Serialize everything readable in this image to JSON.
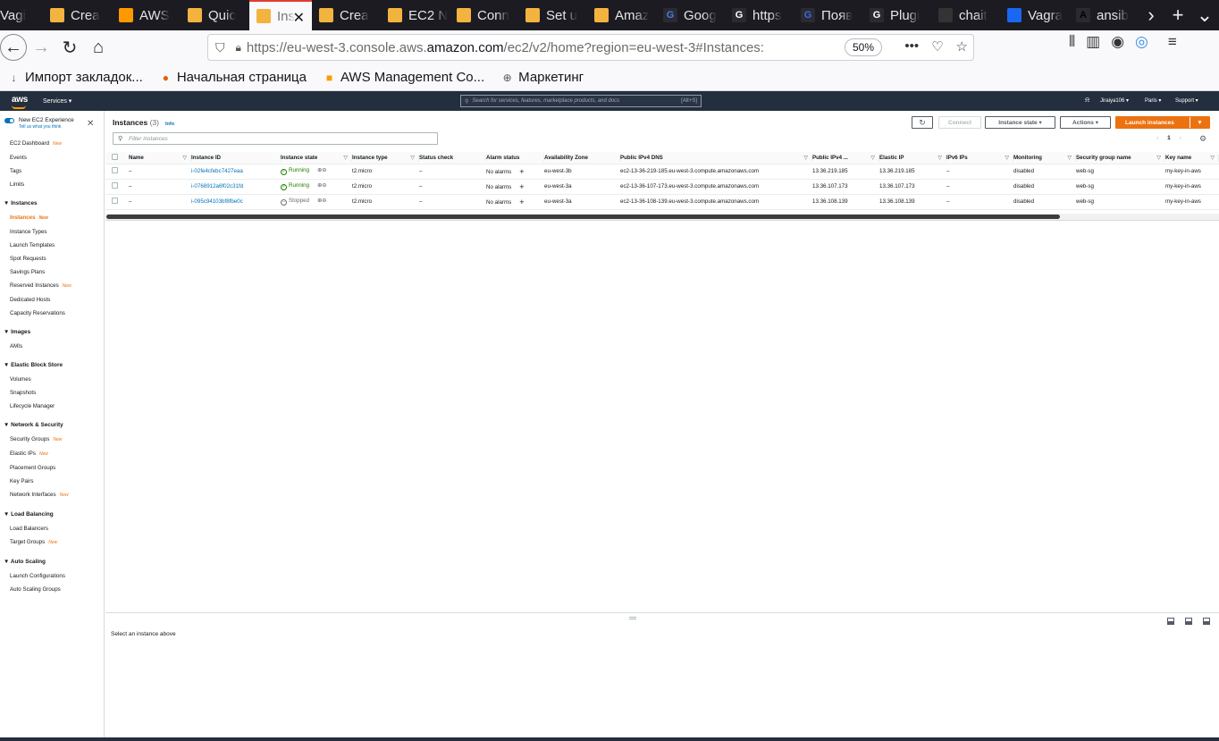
{
  "browser": {
    "tabs": [
      {
        "title": "Vagi",
        "fav": "",
        "fav_color": "#555"
      },
      {
        "title": "Crea",
        "fav": "",
        "fav_color": "#f3b33f"
      },
      {
        "title": "AWS",
        "fav": "",
        "fav_color": "#ff9900"
      },
      {
        "title": "Quic",
        "fav": "",
        "fav_color": "#f3b33f"
      },
      {
        "title": "Ins",
        "fav": "",
        "fav_color": "#f3b33f",
        "active": true
      },
      {
        "title": "Crea",
        "fav": "",
        "fav_color": "#f3b33f"
      },
      {
        "title": "EC2 N",
        "fav": "",
        "fav_color": "#f3b33f"
      },
      {
        "title": "Conn",
        "fav": "",
        "fav_color": "#f3b33f"
      },
      {
        "title": "Set u",
        "fav": "",
        "fav_color": "#f3b33f"
      },
      {
        "title": "Amaz",
        "fav": "",
        "fav_color": "#f3b33f"
      },
      {
        "title": "Goog",
        "fav": "G",
        "fav_color": "#4a7bdc"
      },
      {
        "title": "https",
        "fav": "G",
        "fav_color": "#ffffff"
      },
      {
        "title": "Появ",
        "fav": "G",
        "fav_color": "#3b6de0"
      },
      {
        "title": "Plugi",
        "fav": "G",
        "fav_color": "#ffffff"
      },
      {
        "title": "chait",
        "fav": "",
        "fav_color": "#333"
      },
      {
        "title": "Vagra",
        "fav": "",
        "fav_color": "#1868f2"
      },
      {
        "title": "ansib",
        "fav": "A",
        "fav_color": "#000000"
      }
    ],
    "url_prefix": "https://eu-west-3.console.aws.",
    "url_host": "amazon.com",
    "url_suffix": "/ec2/v2/home?region=eu-west-3#Instances:",
    "zoom": "50%",
    "bookmarks": [
      {
        "label": "Импорт закладок...",
        "icon": "↓",
        "icon_color": "#555"
      },
      {
        "label": "Начальная страница",
        "icon": "●",
        "icon_color": "#e66000"
      },
      {
        "label": "AWS Management Co...",
        "icon": "■",
        "icon_color": "#ff9900"
      },
      {
        "label": "Маркетинг",
        "icon": "⊕",
        "icon_color": "#555"
      }
    ]
  },
  "aws_header": {
    "logo": "aws",
    "services": "Services ▾",
    "search_placeholder": "Search for services, features, marketplace products, and docs",
    "search_hotkey": "[Alt+S]",
    "user": "Jiraiya106 ▾",
    "region": "Paris ▾",
    "support": "Support ▾"
  },
  "sidebar": {
    "new_experience": "New EC2 Experience",
    "tell_us": "Tell us what you think",
    "dashboard": "EC2 Dashboard",
    "events": "Events",
    "tags": "Tags",
    "limits": "Limits",
    "new_tag": "New",
    "sections": {
      "instances": "Instances",
      "images": "Images",
      "ebs": "Elastic Block Store",
      "network": "Network & Security",
      "lb": "Load Balancing",
      "as": "Auto Scaling"
    },
    "items": {
      "instances": "Instances",
      "instance_types": "Instance Types",
      "launch_templates": "Launch Templates",
      "spot_requests": "Spot Requests",
      "savings_plans": "Savings Plans",
      "reserved_instances": "Reserved Instances",
      "dedicated_hosts": "Dedicated Hosts",
      "capacity_reservations": "Capacity Reservations",
      "amis": "AMIs",
      "volumes": "Volumes",
      "snapshots": "Snapshots",
      "lifecycle_manager": "Lifecycle Manager",
      "security_groups": "Security Groups",
      "elastic_ips": "Elastic IPs",
      "placement_groups": "Placement Groups",
      "key_pairs": "Key Pairs",
      "network_interfaces": "Network Interfaces",
      "load_balancers": "Load Balancers",
      "target_groups": "Target Groups",
      "launch_configurations": "Launch Configurations",
      "auto_scaling_groups": "Auto Scaling Groups"
    }
  },
  "main": {
    "title": "Instances",
    "count": "(3)",
    "info": "Info",
    "connect": "Connect",
    "instance_state": "Instance state ▾",
    "actions": "Actions ▾",
    "launch": "Launch instances",
    "filter_placeholder": "Filter instances",
    "page": "1",
    "columns": [
      "Name",
      "Instance ID",
      "Instance state",
      "Instance type",
      "Status check",
      "Alarm status",
      "Availability Zone",
      "Public IPv4 DNS",
      "Public IPv4 ...",
      "Elastic IP",
      "IPv6 IPs",
      "Monitoring",
      "Security group name",
      "Key name"
    ],
    "rows": [
      {
        "name": "–",
        "id": "i-02fe4cfebc7427eaa",
        "state": "Running",
        "type": "t2.micro",
        "status": "–",
        "alarm": "No alarms",
        "az": "eu-west-3b",
        "dns": "ec2-13-36-219-185.eu-west-3.compute.amazonaws.com",
        "ipv4": "13.36.219.185",
        "eip": "13.36.219.185",
        "ipv6": "–",
        "mon": "disabled",
        "sg": "web-sg",
        "key": "my-key-in-aws"
      },
      {
        "name": "–",
        "id": "i-0768912a6f02c31fd",
        "state": "Running",
        "type": "t2.micro",
        "status": "–",
        "alarm": "No alarms",
        "az": "eu-west-3a",
        "dns": "ec2-13-36-107-173.eu-west-3.compute.amazonaws.com",
        "ipv4": "13.36.107.173",
        "eip": "13.36.107.173",
        "ipv6": "–",
        "mon": "disabled",
        "sg": "web-sg",
        "key": "my-key-in-aws"
      },
      {
        "name": "–",
        "id": "i-095c94103bf8fbe0c",
        "state": "Stopped",
        "type": "t2.micro",
        "status": "–",
        "alarm": "No alarms",
        "az": "eu-west-3a",
        "dns": "ec2-13-36-108-139.eu-west-3.compute.amazonaws.com",
        "ipv4": "13.36.108.139",
        "eip": "13.36.108.139",
        "ipv6": "–",
        "mon": "disabled",
        "sg": "web-sg",
        "key": "my-key-in-aws"
      }
    ]
  },
  "split": {
    "message": "Select an instance above"
  },
  "colors": {
    "accent": "#ec7211",
    "link": "#0073bb",
    "running": "#1d8102",
    "header": "#232f3e"
  }
}
